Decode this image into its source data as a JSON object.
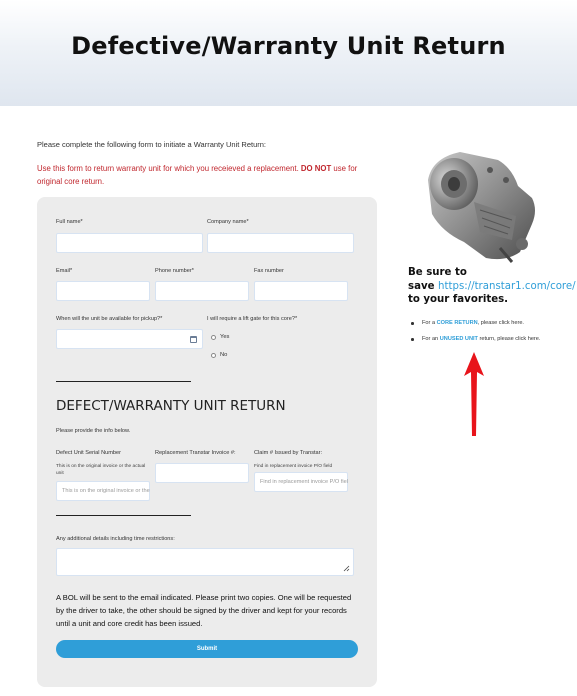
{
  "page": {
    "title": "Defective/Warranty Unit Return",
    "intro": "Please complete the following form to initiate a Warranty Unit Return:",
    "warning_prefix": "Use this form to return warranty unit for which you receieved a replacement. ",
    "warning_bold": "DO NOT",
    "warning_suffix": " use for original core return."
  },
  "form": {
    "full_name_label": "Full name*",
    "company_name_label": "Company name*",
    "email_label": "Email*",
    "phone_label": "Phone number*",
    "fax_label": "Fax number",
    "pickup_label": "When will the unit be available for pickup?*",
    "liftgate_label": "I will require a lift gate for this core?*",
    "liftgate_options": [
      "Yes",
      "No"
    ],
    "section_title": "DEFECT/WARRANTY UNIT RETURN",
    "section_help": "Please provide the info below.",
    "serial_label": "Defect Unit Serial Number",
    "serial_help": "This is on the original invoice or the actual unit",
    "serial_placeholder": "This is on the original invoice or the actual unit",
    "invoice_label": "Replacement Transtar Invoice #:",
    "claim_label": "Claim # Issued by Transtar:",
    "claim_help": "Find in replacement invoice P/O field",
    "claim_placeholder": "Find in replacement invoice P/O field",
    "details_label": "Any additional details including time restrictions:",
    "bol_text": "A BOL will be sent to the email indicated. Please print two copies. One will be requested by the driver to take, the other should be signed by the driver and kept for your records until a unit and core credit has been issued.",
    "submit_label": "Submit"
  },
  "sidebar": {
    "heading_line1": "Be sure to",
    "heading_save": "save ",
    "heading_link": "https://transtar1.com/core/",
    "heading_line3": "to your favorites.",
    "item1_prefix": "For a ",
    "item1_highlight": "CORE RETURN",
    "item1_suffix": ", please click here.",
    "item2_prefix": "For an ",
    "item2_highlight": "UNUSED UNIT",
    "item2_suffix": " return, please click here."
  },
  "colors": {
    "accent": "#2f9ed8",
    "warning": "#c0262d",
    "arrow": "#e8141b"
  }
}
